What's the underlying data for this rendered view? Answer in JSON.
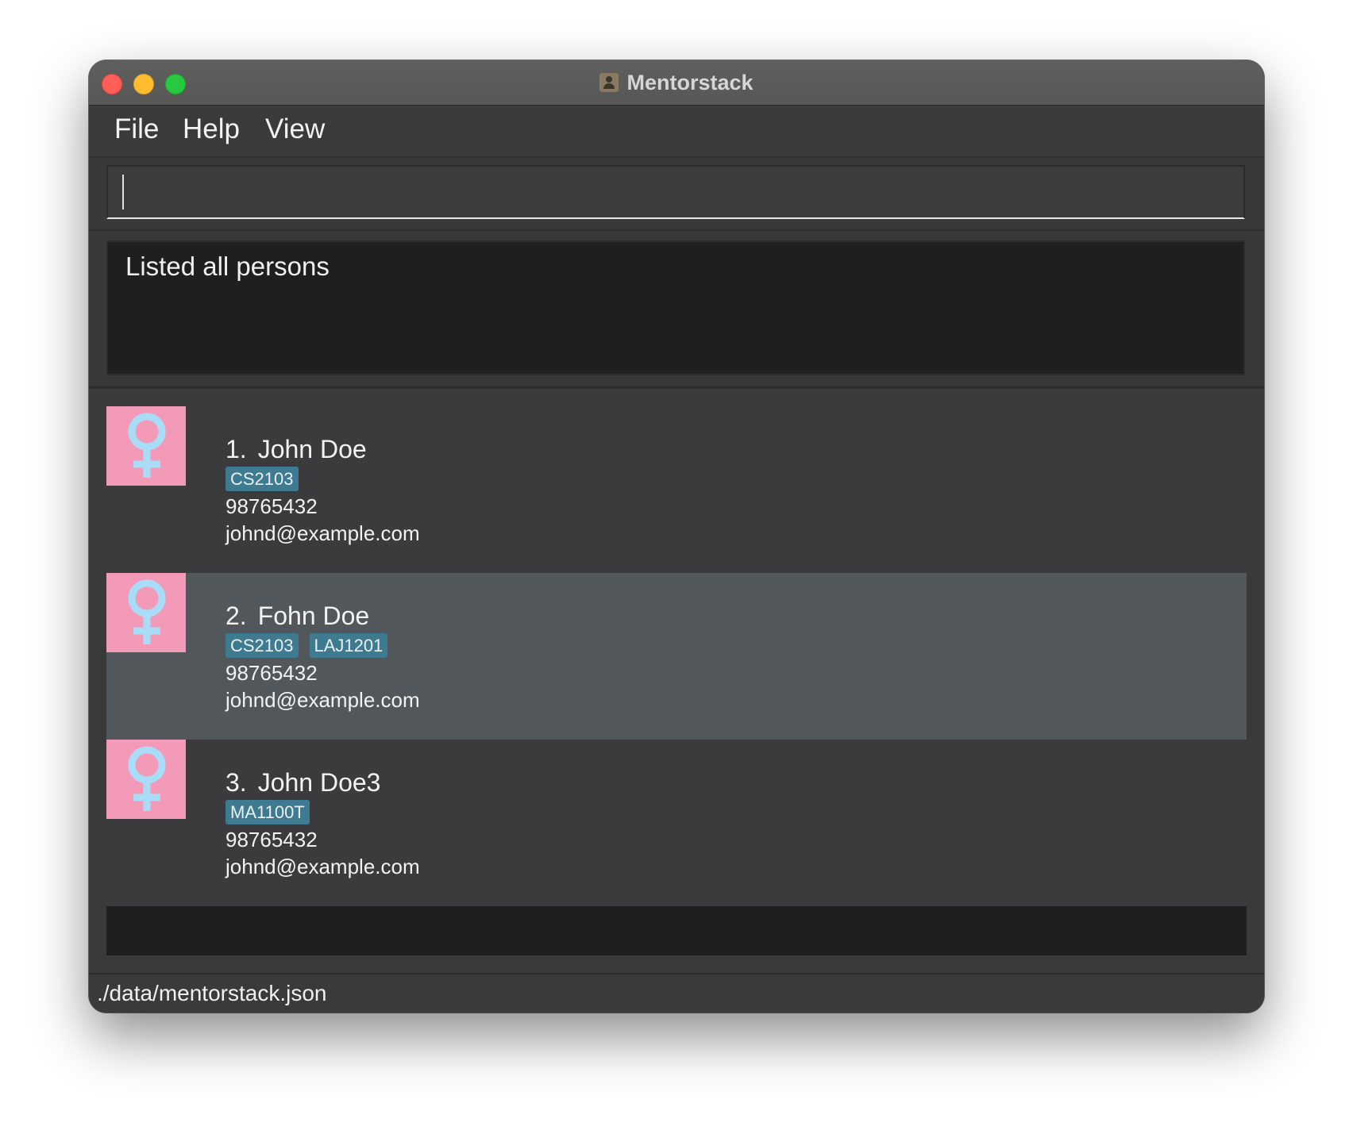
{
  "window": {
    "title": "Mentorstack",
    "app_icon": "contacts-app-icon"
  },
  "menu": {
    "items": [
      "File",
      "Help",
      "View"
    ]
  },
  "command": {
    "value": "",
    "placeholder": ""
  },
  "result": {
    "message": "Listed all persons"
  },
  "persons": [
    {
      "index": "1.",
      "name": "John Doe",
      "tags": [
        "CS2103"
      ],
      "phone": "98765432",
      "email": "johnd@example.com",
      "avatar_icon": "female-symbol-icon",
      "selected": false
    },
    {
      "index": "2.",
      "name": "Fohn Doe",
      "tags": [
        "CS2103",
        "LAJ1201"
      ],
      "phone": "98765432",
      "email": "johnd@example.com",
      "avatar_icon": "female-symbol-icon",
      "selected": true
    },
    {
      "index": "3.",
      "name": "John Doe3",
      "tags": [
        "MA1100T"
      ],
      "phone": "98765432",
      "email": "johnd@example.com",
      "avatar_icon": "female-symbol-icon",
      "selected": false
    }
  ],
  "status": {
    "file_path": "./data/mentorstack.json"
  },
  "colors": {
    "avatar_bg": "#f49ab9",
    "avatar_symbol": "#a9ddf7",
    "tag_bg": "#3e7b91",
    "selected_row": "#51575b"
  }
}
